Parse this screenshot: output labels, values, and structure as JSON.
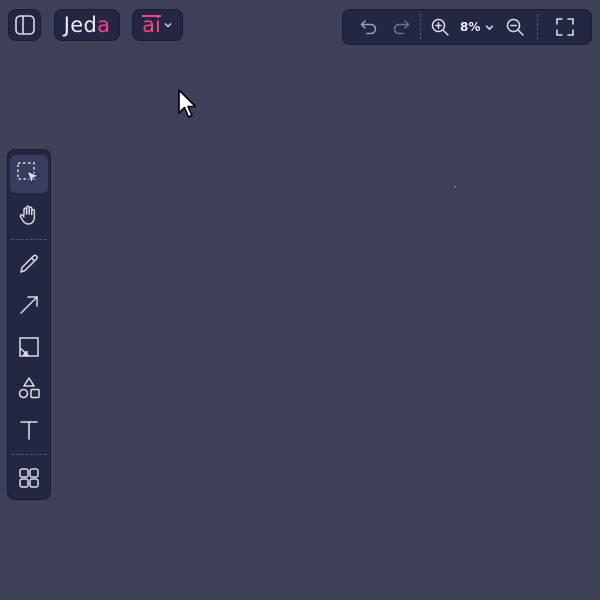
{
  "app": {
    "brand_main": "Jed",
    "brand_accent": "a",
    "ai_label": "ai"
  },
  "toolbar": {
    "zoom_level": "8%",
    "buttons": [
      "undo-icon",
      "redo-icon",
      "zoom-in-icon",
      "zoom-out-icon",
      "fullscreen-icon"
    ]
  },
  "tools": [
    {
      "name": "select",
      "icon": "select-icon",
      "active": true
    },
    {
      "name": "hand",
      "icon": "hand-icon"
    },
    {
      "name": "pencil",
      "icon": "pencil-icon"
    },
    {
      "name": "arrow",
      "icon": "arrow-icon"
    },
    {
      "name": "image",
      "icon": "image-icon"
    },
    {
      "name": "shapes",
      "icon": "shapes-icon"
    },
    {
      "name": "text",
      "icon": "text-icon"
    },
    {
      "name": "components",
      "icon": "grid-icon"
    }
  ],
  "colors": {
    "background": "#3e4159",
    "panel": "#242741",
    "accent": "#f0457f",
    "icon": "#d9dbe8"
  }
}
